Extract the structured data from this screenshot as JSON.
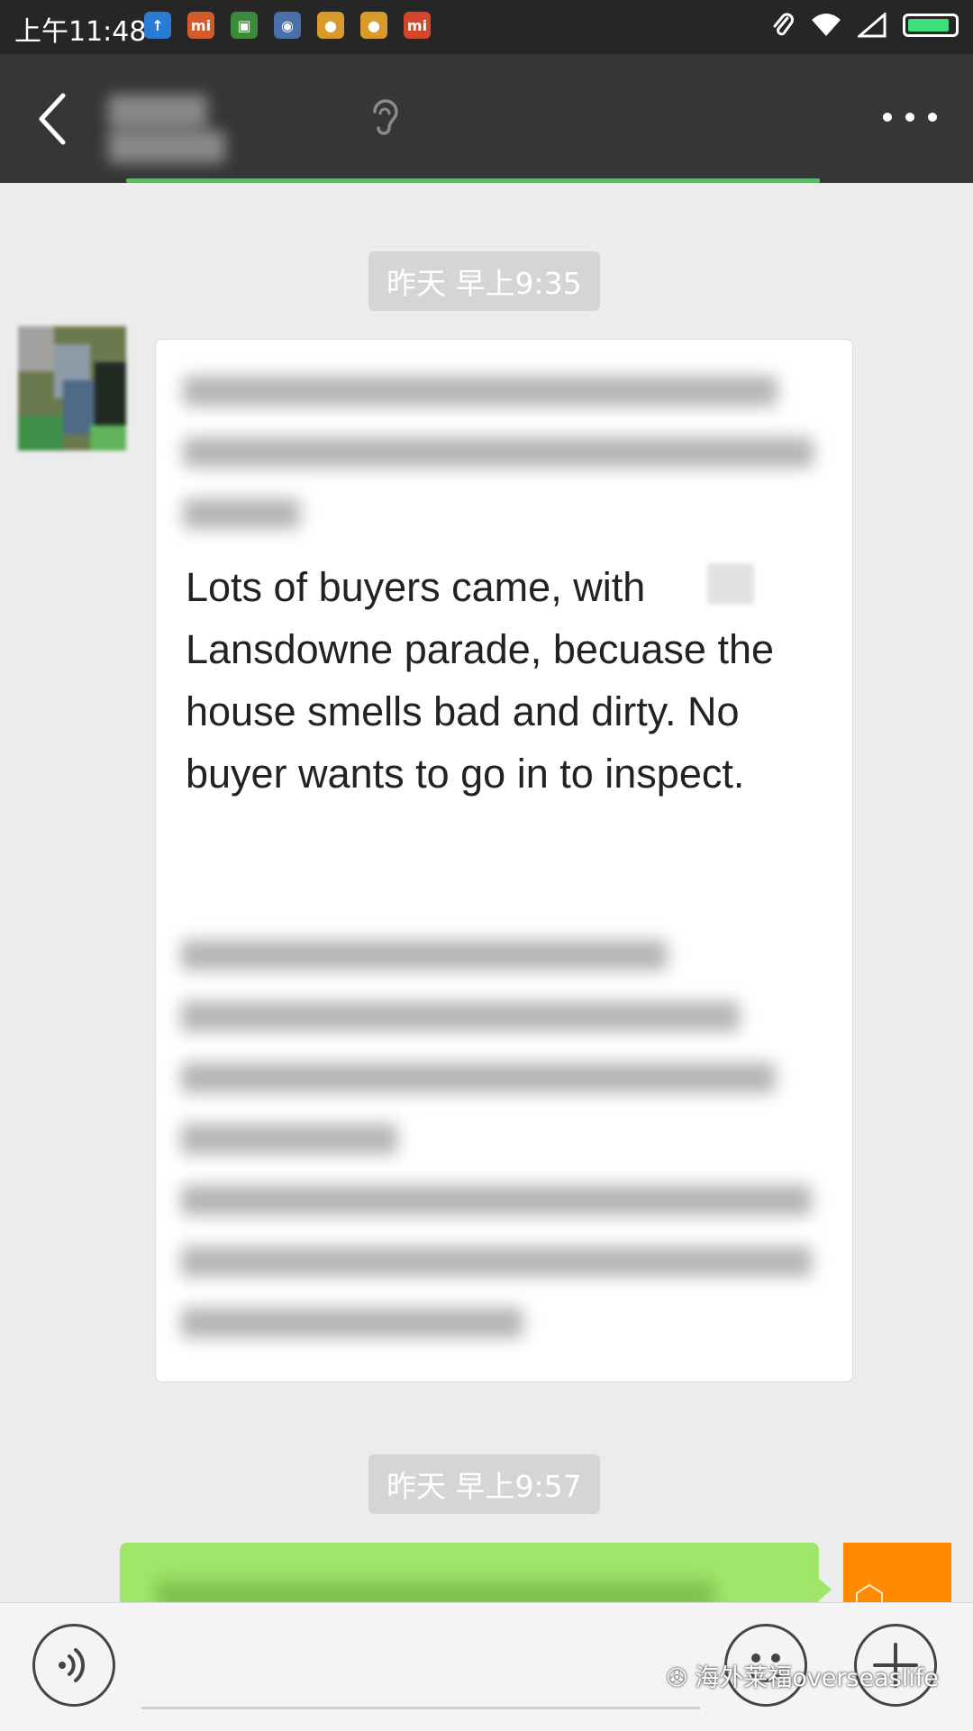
{
  "status_bar": {
    "time": "上午11:48",
    "notification_icons": [
      {
        "name": "upload-icon",
        "color": "#2a7bd4",
        "glyph": "↑"
      },
      {
        "name": "mi-app-icon",
        "color": "#d45a2a",
        "glyph": "mi"
      },
      {
        "name": "android-icon",
        "color": "#3d8a3d",
        "glyph": "▣"
      },
      {
        "name": "camera-icon",
        "color": "#4b6fa8",
        "glyph": "◉"
      },
      {
        "name": "app-badge-icon",
        "color": "#d89a2a",
        "glyph": "●"
      },
      {
        "name": "app-badge-icon-2",
        "color": "#d89a2a",
        "glyph": "●"
      },
      {
        "name": "mi-store-icon",
        "color": "#d4462a",
        "glyph": "mi"
      }
    ],
    "battery_level": 0.9
  },
  "chat": {
    "timestamps": [
      "昨天 早上9:35",
      "昨天 早上9:57"
    ],
    "message_text": "Lots of buyers came, with  Lansdowne parade, becuase the house smells bad and dirty. No buyer wants to go in to inspect."
  },
  "colors": {
    "nav_bg": "#363636",
    "status_bg": "#262626",
    "chat_bg": "#ececec",
    "own_bubble": "#9fe66a",
    "self_avatar": "#ff8a00"
  },
  "watermark": "海外莱福overseaslife"
}
